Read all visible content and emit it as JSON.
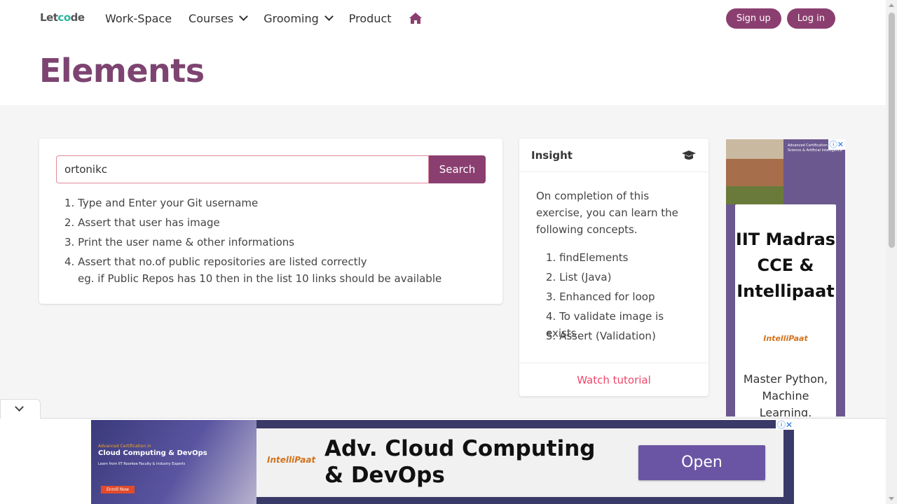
{
  "header": {
    "logo": {
      "left": "Let",
      "mid": "c",
      "o": "o",
      "right": "de"
    },
    "nav": [
      "Work-Space",
      "Courses",
      "Grooming",
      "Product"
    ],
    "home_icon": "home-icon",
    "signup": "Sign up",
    "login": "Log in"
  },
  "page": {
    "title": "Elements"
  },
  "search": {
    "value": "ortonikc",
    "button": "Search"
  },
  "steps": [
    "1. Type and Enter your Git username",
    "2. Assert that user has image",
    "3. Print the user name & other informations",
    "4. Assert that no.of public repositories are listed correctly",
    "eg. if Public Repos has 10 then in the list 10 links should be available"
  ],
  "insight": {
    "title": "Insight",
    "icon": "graduation-cap-icon",
    "intro": "On completion of this exercise, you can learn the following concepts.",
    "concepts": [
      "1. findElements",
      "2. List (Java)",
      "3. Enhanced for loop",
      "4. To validate image is exists",
      "5. Assert (Validation)"
    ],
    "footer": "Watch tutorial"
  },
  "side_ad": {
    "mini_text": "Advanced Certification in Data Science & Artificial Intelligence",
    "headline": "IIT Madras CCE & Intellipaat",
    "brand": "IntelliPaat",
    "desc": "Master Python, Machine Learning,"
  },
  "banner": {
    "tag1": "Advanced Certification in",
    "tag2": "Cloud Computing & DevOps",
    "tag3": "Learn from IIT Roorkee Faculty & Industry Experts",
    "enroll": "Enroll Now",
    "logo": "IntelliPaat",
    "headline": "Adv. Cloud Computing & DevOps",
    "open": "Open"
  },
  "colors": {
    "brand": "#8b3f70",
    "title": "#7d4471",
    "link": "#f14668"
  }
}
